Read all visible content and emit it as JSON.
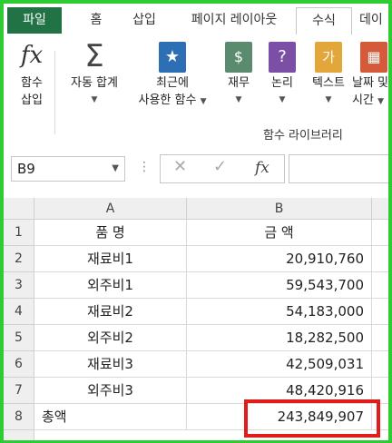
{
  "ribbon": {
    "tabs": [
      {
        "label": "파일"
      },
      {
        "label": "홈"
      },
      {
        "label": "삽입"
      },
      {
        "label": "페이지 레이아웃"
      },
      {
        "label": "수식"
      },
      {
        "label": "데이"
      }
    ],
    "buttons": {
      "insert_function": {
        "line1": "함수",
        "line2": "삽입",
        "icon": "fx"
      },
      "autosum": {
        "line1": "자동 합계",
        "icon": "Σ"
      },
      "recent": {
        "line1": "최근에",
        "line2": "사용한 함수",
        "icon": "★"
      },
      "financial": {
        "line1": "재무",
        "icon": "$"
      },
      "logical": {
        "line1": "논리",
        "icon": "?"
      },
      "text": {
        "line1": "텍스트",
        "icon": "가"
      },
      "datetime": {
        "line1": "날짜 및",
        "line2": "시간",
        "icon": "▦"
      }
    },
    "group_label": "함수 라이브러리"
  },
  "formula_bar": {
    "name_box": "B9",
    "fx_label": "fx",
    "cancel_icon": "✕",
    "enter_icon": "✓",
    "formula": ""
  },
  "sheet": {
    "columns": [
      "A",
      "B"
    ],
    "rows": [
      {
        "num": "1",
        "a": "품   명",
        "b": "금   액"
      },
      {
        "num": "2",
        "a": "재료비1",
        "b": "20,910,760"
      },
      {
        "num": "3",
        "a": "외주비1",
        "b": "59,543,700"
      },
      {
        "num": "4",
        "a": "재료비2",
        "b": "54,183,000"
      },
      {
        "num": "5",
        "a": "외주비2",
        "b": "18,282,500"
      },
      {
        "num": "6",
        "a": "재료비3",
        "b": "42,509,031"
      },
      {
        "num": "7",
        "a": "외주비3",
        "b": "48,420,916"
      },
      {
        "num": "8",
        "a": "총액",
        "b": "243,849,907"
      }
    ]
  },
  "colors": {
    "frame": "#2ecc33",
    "file_tab": "#217346",
    "highlight": "#e21b1b"
  }
}
